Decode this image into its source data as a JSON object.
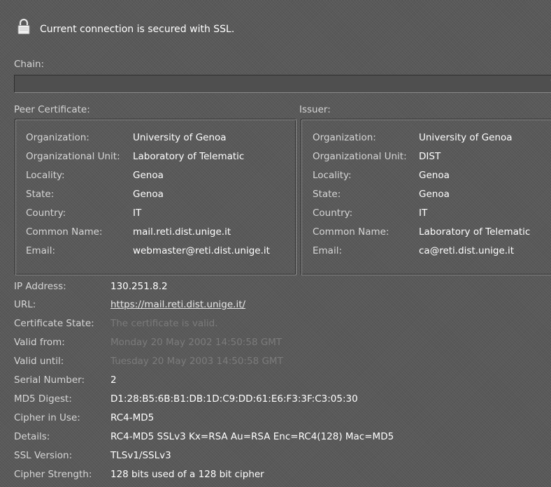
{
  "header": {
    "icon": "lock-icon",
    "title": "Current connection is secured with SSL."
  },
  "chain": {
    "label": "Chain:",
    "selected": ""
  },
  "peer": {
    "label": "Peer Certificate:",
    "fields": [
      {
        "key": "Organization:",
        "value": "University of Genoa"
      },
      {
        "key": "Organizational Unit:",
        "value": "Laboratory of Telematic"
      },
      {
        "key": "Locality:",
        "value": "Genoa"
      },
      {
        "key": "State:",
        "value": "Genoa"
      },
      {
        "key": "Country:",
        "value": "IT"
      },
      {
        "key": "Common Name:",
        "value": "mail.reti.dist.unige.it"
      },
      {
        "key": "Email:",
        "value": "webmaster@reti.dist.unige.it"
      }
    ]
  },
  "issuer": {
    "label": "Issuer:",
    "fields": [
      {
        "key": "Organization:",
        "value": "University of Genoa"
      },
      {
        "key": "Organizational Unit:",
        "value": "DIST"
      },
      {
        "key": "Locality:",
        "value": "Genoa"
      },
      {
        "key": "State:",
        "value": "Genoa"
      },
      {
        "key": "Country:",
        "value": "IT"
      },
      {
        "key": "Common Name:",
        "value": "Laboratory of Telematic"
      },
      {
        "key": "Email:",
        "value": "ca@reti.dist.unige.it"
      }
    ]
  },
  "info": {
    "ip": {
      "key": "IP Address:",
      "value": "130.251.8.2"
    },
    "url": {
      "key": "URL:",
      "value": "https://mail.reti.dist.unige.it/"
    },
    "state": {
      "key": "Certificate State:",
      "value": "The certificate is valid."
    },
    "valid_from": {
      "key": "Valid from:",
      "value": "Monday 20 May 2002 14:50:58 GMT"
    },
    "valid_until": {
      "key": "Valid until:",
      "value": "Tuesday 20 May 2003 14:50:58 GMT"
    },
    "serial": {
      "key": "Serial Number:",
      "value": "2"
    },
    "md5": {
      "key": "MD5 Digest:",
      "value": "D1:28:B5:6B:B1:DB:1D:C9:DD:61:E6:F3:3F:C3:05:30"
    },
    "cipher": {
      "key": "Cipher in Use:",
      "value": "RC4-MD5"
    },
    "details": {
      "key": "Details:",
      "value": "RC4-MD5 SSLv3 Kx=RSA Au=RSA Enc=RC4(128) Mac=MD5"
    },
    "ssl_version": {
      "key": "SSL Version:",
      "value": "TLSv1/SSLv3"
    },
    "strength": {
      "key": "Cipher Strength:",
      "value": "128 bits used of a 128 bit cipher"
    }
  }
}
